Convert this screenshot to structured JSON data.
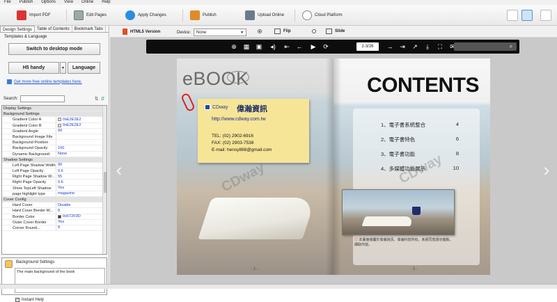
{
  "menu": [
    "File",
    "Publish",
    "Options",
    "View",
    "Online",
    "Help"
  ],
  "toolbar": {
    "import_pdf": "Import PDF",
    "edit_pages": "Edit Pages",
    "apply_changes": "Apply Changes",
    "publish": "Publish",
    "upload_online": "Upload Online",
    "cloud_platform": "Cloud Platform"
  },
  "left_panel": {
    "tabs": [
      "Design Settings",
      "Table of Contents",
      "Bookmark Tabs"
    ],
    "templates_label": "Templates & Language",
    "switch_desktop": "Switch to desktop mode",
    "template_value": "H5 handy",
    "language_button": "Language",
    "more_templates_link": "Get more free online templates here.",
    "search_label": "Search:",
    "properties": [
      {
        "type": "cat",
        "name": "Display Settings"
      },
      {
        "type": "cat",
        "name": "Background Settings"
      },
      {
        "type": "prop",
        "name": "Gradient Color A",
        "value": "0xE2E2E2",
        "swatch": "#E2E2E2"
      },
      {
        "type": "prop",
        "name": "Gradient Color B",
        "value": "0xE2E2E2",
        "swatch": "#E2E2E2"
      },
      {
        "type": "prop",
        "name": "Gradient Angle",
        "value": "90"
      },
      {
        "type": "prop",
        "name": "Background Image File",
        "value": ""
      },
      {
        "type": "prop",
        "name": "Background Position",
        "value": ""
      },
      {
        "type": "prop",
        "name": "Background Opacity",
        "value": "100"
      },
      {
        "type": "prop",
        "name": "Dynamic Background",
        "value": "None"
      },
      {
        "type": "cat",
        "name": "Shadow Settings"
      },
      {
        "type": "prop",
        "name": "Left Page Shadow Width",
        "value": "90"
      },
      {
        "type": "prop",
        "name": "Left Page Opacity",
        "value": "0.6"
      },
      {
        "type": "prop",
        "name": "Right Page Shadow W...",
        "value": "55"
      },
      {
        "type": "prop",
        "name": "Right Page Opacity",
        "value": "0.6"
      },
      {
        "type": "prop",
        "name": "Show TopLeft Shadow",
        "value": "Yes"
      },
      {
        "type": "prop",
        "name": "page highlight type",
        "value": "magazine"
      },
      {
        "type": "cat",
        "name": "Cover Config"
      },
      {
        "type": "prop",
        "name": "Hard Cover",
        "value": "Disable"
      },
      {
        "type": "prop",
        "name": "Hard Cover Border W...",
        "value": "8"
      },
      {
        "type": "prop",
        "name": "Border Color",
        "value": "0x572F0D",
        "swatch": "#572F0D"
      },
      {
        "type": "prop",
        "name": "Outer Cover Border",
        "value": "Yes"
      },
      {
        "type": "prop",
        "name": "Corner Round...",
        "value": "8"
      }
    ],
    "desc_title": "Background Settings",
    "desc_text": "The main background of the book",
    "instant_help": "Instant Help"
  },
  "stage": {
    "html5_version": "HTML5 Version",
    "device_label": "Device:",
    "device_value": "None",
    "flip_label": "Flip",
    "slide_label": "Slide",
    "page_indicator": "2-3/26"
  },
  "book": {
    "left": {
      "ebook_title": "eBOOK",
      "company_en": "CDway",
      "company_cn": "偉瀚資訊",
      "url": "http://www.cdway.com.tw",
      "tel": "TEL: (02) 2902-6916",
      "fax": "FAX: (02) 2903-7538",
      "email": "E-mail: hensy888@gmail.com",
      "watermark": "CDway",
      "page_number": "- 2 -"
    },
    "right": {
      "title": "CONTENTS",
      "toc": [
        {
          "label": "1、電子書系統整合",
          "page": "4"
        },
        {
          "label": "2、電子書特色",
          "page": "6"
        },
        {
          "label": "3、電子書功能",
          "page": "8"
        },
        {
          "label": "4、多媒體功能展示",
          "page": "10"
        }
      ],
      "watermark": "CDway",
      "caption": "本畫冊僅屬於偉瀚資訊，偉瀚科技所有，未經同意請勿複製，擷取內容。",
      "caption_mark": "◎",
      "page_number": "- 3 -"
    }
  },
  "colors": {
    "accent": "#1a4fd6",
    "viewer_bar": "#0d0d0d",
    "stage_bg": "#c9c9c9"
  }
}
